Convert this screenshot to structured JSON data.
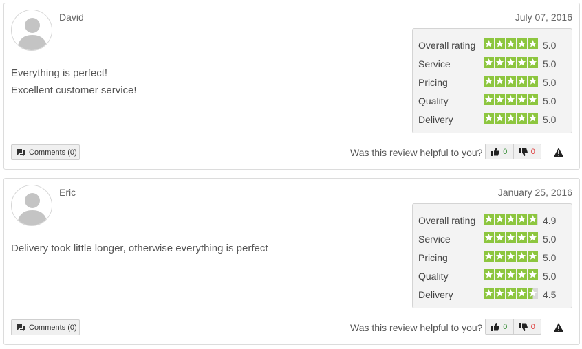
{
  "reviews": [
    {
      "author": "David",
      "date": "July 07, 2016",
      "text_lines": [
        "Everything is perfect!",
        "Excellent customer service!"
      ],
      "ratings": [
        {
          "label": "Overall rating",
          "value": "5.0",
          "stars": 5
        },
        {
          "label": "Service",
          "value": "5.0",
          "stars": 5
        },
        {
          "label": "Pricing",
          "value": "5.0",
          "stars": 5
        },
        {
          "label": "Quality",
          "value": "5.0",
          "stars": 5
        },
        {
          "label": "Delivery",
          "value": "5.0",
          "stars": 5
        }
      ],
      "comments_label": "Comments (0)",
      "helpful_label": "Was this review helpful to you?",
      "up_votes": "0",
      "down_votes": "0"
    },
    {
      "author": "Eric",
      "date": "January 25, 2016",
      "text_lines": [
        "Delivery took little longer, otherwise everything is perfect"
      ],
      "ratings": [
        {
          "label": "Overall rating",
          "value": "4.9",
          "stars": 4.9
        },
        {
          "label": "Service",
          "value": "5.0",
          "stars": 5
        },
        {
          "label": "Pricing",
          "value": "5.0",
          "stars": 5
        },
        {
          "label": "Quality",
          "value": "5.0",
          "stars": 5
        },
        {
          "label": "Delivery",
          "value": "4.5",
          "stars": 4.5
        }
      ],
      "comments_label": "Comments (0)",
      "helpful_label": "Was this review helpful to you?",
      "up_votes": "0",
      "down_votes": "0"
    }
  ],
  "colors": {
    "star_fill": "#8dc63f",
    "star_empty": "#d9d9d9",
    "up_vote": "#3a8f3a",
    "down_vote": "#dd3333"
  },
  "icons": [
    "user-avatar-icon",
    "comments-icon",
    "thumbs-up-icon",
    "thumbs-down-icon",
    "warning-icon",
    "star-icon"
  ]
}
